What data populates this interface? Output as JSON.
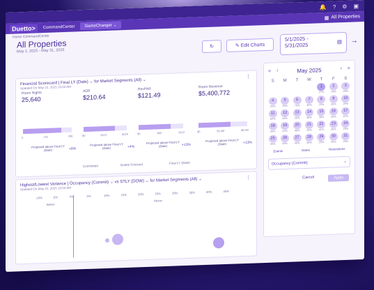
{
  "topbar": {
    "icons": [
      "bell-icon",
      "help-icon",
      "gear-icon",
      "chat-icon"
    ]
  },
  "nav": {
    "logo": "Duetto>",
    "product": "CommandCenter",
    "tab": "GameChanger ⌄",
    "property": "All Properties"
  },
  "breadcrumb": "Home     CommandCenter",
  "page": {
    "title": "All Properties",
    "dates": "May 1, 2025 - May 31, 2025"
  },
  "toolbar": {
    "refresh_icon": "refresh-icon",
    "edit_label": "Edit Charts",
    "date_start": "5/1/2025 -",
    "date_end": "5/31/2025"
  },
  "scorecard": {
    "title": "Financial Scorecard | Final LY (Date) ⌄ for Market Segments (All) ⌄",
    "updated": "Updated On May 22, 2025 10:04 AM",
    "metrics": [
      {
        "label": "Room Nights",
        "value": "25,640",
        "ticks": [
          "0",
          "17K",
          "30K"
        ],
        "proj": "Projected above Final LY (Date)",
        "pct": "+8%"
      },
      {
        "label": "ADR",
        "value": "$210.64",
        "ticks": [
          "$0",
          "$110",
          "$220"
        ],
        "proj": "Projected above Final LY (Date)",
        "pct": "+4%"
      },
      {
        "label": "RevPAR",
        "value": "$121.49",
        "ticks": [
          "$0",
          "$60",
          "$110"
        ],
        "proj": "Projected above Final LY (Date)",
        "pct": "+13%"
      },
      {
        "label": "Room Revenue",
        "value": "$5,400,772",
        "ticks": [
          "$0",
          "$3.4M",
          "$6.8M"
        ],
        "proj": "Projected above Final LY (Date)",
        "pct": "+13%"
      }
    ],
    "legend": [
      "Committed",
      "Duetto Forecast",
      "Final LY (Date)"
    ]
  },
  "variance": {
    "title": "Highest/Lowest Variance | Occupancy (Commit) ⌄ vs STLY (DOW) ⌄ for Market Segments (All) ⌄",
    "updated": "Updated On May 22, 2025 10:04 AM",
    "ticks": [
      "-10%",
      "-5%",
      "0%",
      "5%",
      "10%",
      "15%",
      "20%",
      "25%",
      "30%",
      "35%",
      "40%",
      "45%"
    ],
    "below": "Below",
    "above": "Above"
  },
  "calendar": {
    "month": "May 2025",
    "dow": [
      "S",
      "M",
      "T",
      "W",
      "T",
      "F",
      "S"
    ],
    "days": [
      {
        "n": "",
        "p": ""
      },
      {
        "n": "",
        "p": ""
      },
      {
        "n": "",
        "p": ""
      },
      {
        "n": "",
        "p": ""
      },
      {
        "n": "1",
        "p": "27%"
      },
      {
        "n": "2",
        "p": "75%"
      },
      {
        "n": "3",
        "p": "45%"
      },
      {
        "n": "4",
        "p": "25%"
      },
      {
        "n": "5",
        "p": "25%"
      },
      {
        "n": "6",
        "p": "75%"
      },
      {
        "n": "7",
        "p": "45%"
      },
      {
        "n": "8",
        "p": "25%"
      },
      {
        "n": "9",
        "p": "25%"
      },
      {
        "n": "10",
        "p": "25%"
      },
      {
        "n": "11",
        "p": "62%"
      },
      {
        "n": "12",
        "p": "44%"
      },
      {
        "n": "13",
        "p": "25%"
      },
      {
        "n": "14",
        "p": "58%"
      },
      {
        "n": "15",
        "p": "38%"
      },
      {
        "n": "16",
        "p": "25%"
      },
      {
        "n": "17",
        "p": "41%"
      },
      {
        "n": "18",
        "p": "25%"
      },
      {
        "n": "19",
        "p": "41%"
      },
      {
        "n": "20",
        "p": "46%"
      },
      {
        "n": "21",
        "p": "25%"
      },
      {
        "n": "22",
        "p": "41%"
      },
      {
        "n": "23",
        "p": "25%"
      },
      {
        "n": "24",
        "p": "25%"
      },
      {
        "n": "25",
        "p": "45%"
      },
      {
        "n": "26",
        "p": "45%"
      },
      {
        "n": "27",
        "p": "40%"
      },
      {
        "n": "28",
        "p": "45%"
      },
      {
        "n": "29",
        "p": "25%"
      },
      {
        "n": "30",
        "p": "25%"
      },
      {
        "n": "31",
        "p": "25%"
      }
    ],
    "tabs": [
      "Events",
      "Notes",
      "Restrictions"
    ],
    "occupancy": "Occupancy (Commit)",
    "cancel": "Cancel",
    "apply": "Apply"
  }
}
